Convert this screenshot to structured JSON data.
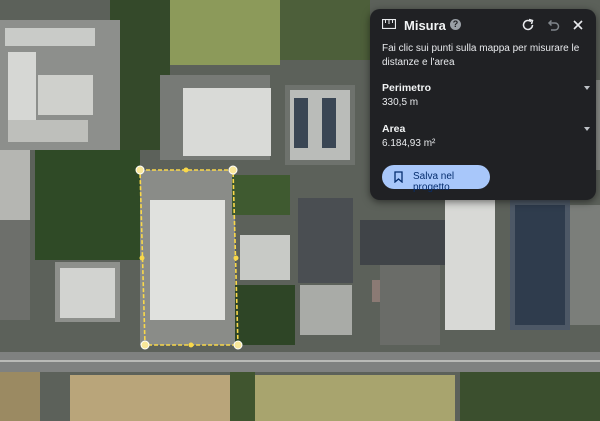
{
  "panel": {
    "title": "Misura",
    "help_icon": "?",
    "description": "Fai clic sui punti sulla mappa per misurare le distanze e l'area",
    "perimeter": {
      "label": "Perimetro",
      "value": "330,5 m"
    },
    "area": {
      "label": "Area",
      "value": "6.184,93 m²"
    },
    "save_label": "Salva nel progetto",
    "icons": [
      "ruler-icon",
      "help-icon",
      "refresh-icon",
      "undo-icon",
      "close-icon",
      "bookmark-icon",
      "chevron-down-icon"
    ]
  },
  "colors": {
    "panel_bg": "#202124",
    "button_bg": "#a8c7fa",
    "button_text": "#062e6f",
    "measure_line": "#f9d84a"
  }
}
